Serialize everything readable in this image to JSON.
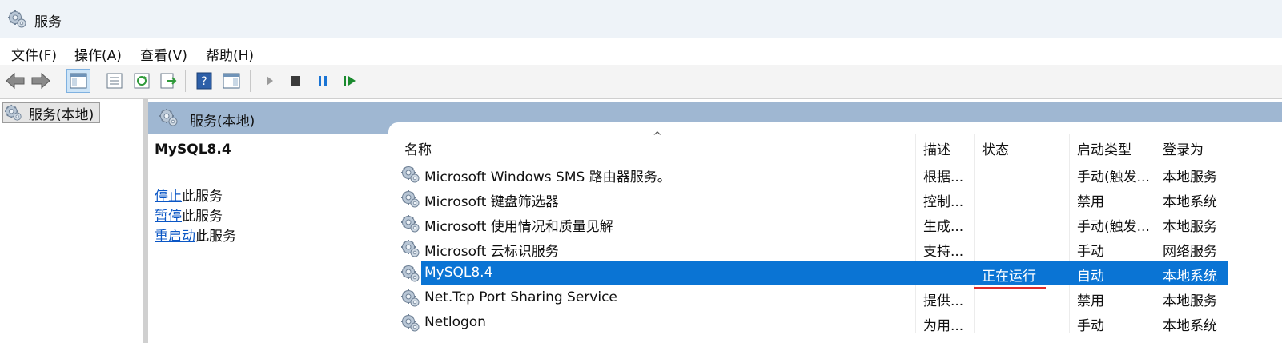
{
  "window": {
    "title": "服务",
    "icon": "gear-services-icon"
  },
  "menu": [
    "文件(F)",
    "操作(A)",
    "查看(V)",
    "帮助(H)"
  ],
  "toolbar": {
    "buttons": [
      "back-arrow-icon",
      "forward-arrow-icon",
      "show-hide-console-tree-icon",
      "properties-icon",
      "refresh-icon",
      "export-list-icon",
      "help-icon",
      "view-icon",
      "start-icon",
      "stop-icon",
      "pause-icon",
      "resume-icon"
    ]
  },
  "tree": {
    "root_label": "服务(本地)"
  },
  "panel": {
    "title": "服务(本地)"
  },
  "description": {
    "service_name": "MySQL8.4",
    "actions": [
      {
        "link": "停止",
        "rest": "此服务"
      },
      {
        "link": "暂停",
        "rest": "此服务"
      },
      {
        "link": "重启动",
        "rest": "此服务"
      }
    ]
  },
  "columns": {
    "name": "名称",
    "desc": "描述",
    "status": "状态",
    "startup": "启动类型",
    "logon": "登录为",
    "sort_indicator": "^"
  },
  "rows": [
    {
      "name": "Microsoft Windows SMS 路由器服务。",
      "desc": "根据...",
      "status": "",
      "startup": "手动(触发...",
      "logon": "本地服务"
    },
    {
      "name": "Microsoft 键盘筛选器",
      "desc": "控制...",
      "status": "",
      "startup": "禁用",
      "logon": "本地系统"
    },
    {
      "name": "Microsoft 使用情况和质量见解",
      "desc": "生成...",
      "status": "",
      "startup": "手动(触发...",
      "logon": "本地服务"
    },
    {
      "name": "Microsoft 云标识服务",
      "desc": "支持...",
      "status": "",
      "startup": "手动",
      "logon": "网络服务"
    },
    {
      "name": "MySQL8.4",
      "desc": "",
      "status": "正在运行",
      "startup": "自动",
      "logon": "本地系统",
      "selected": true
    },
    {
      "name": "Net.Tcp Port Sharing Service",
      "desc": "提供...",
      "status": "",
      "startup": "禁用",
      "logon": "本地服务"
    },
    {
      "name": "Netlogon",
      "desc": "为用...",
      "status": "",
      "startup": "手动",
      "logon": "本地系统"
    }
  ],
  "colors": {
    "selection": "#0a74d4",
    "header": "#9fb7d2",
    "link": "#0a56c5",
    "annotation": "#e02a2a"
  }
}
